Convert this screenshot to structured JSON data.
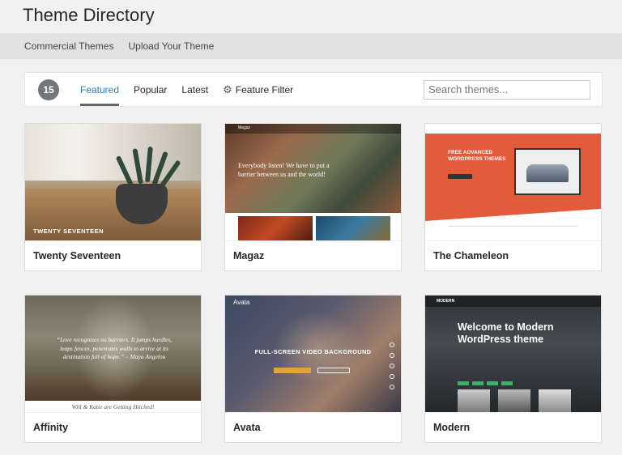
{
  "header": {
    "title": "Theme Directory"
  },
  "subnav": {
    "items": [
      "Commercial Themes",
      "Upload Your Theme"
    ]
  },
  "filter": {
    "count": "15",
    "tabs": [
      "Featured",
      "Popular",
      "Latest",
      "Feature Filter"
    ],
    "active_tab": "Featured",
    "search_placeholder": "Search themes..."
  },
  "themes": [
    {
      "name": "Twenty Seventeen",
      "preview_caption": "TWENTY SEVENTEEN"
    },
    {
      "name": "Magaz",
      "preview_logo": "Magaz",
      "preview_quote": "Everybody listen! We have to put a barrier between us and the world!"
    },
    {
      "name": "The Chameleon",
      "preview_heading": "FREE ADVANCED WORDPRESS THEMES"
    },
    {
      "name": "Affinity",
      "preview_quote": "“Love recognizes no barriers. It jumps hurdles, leaps fences, penetrates walls to arrive at its destination full of hope.” – Maya Angelou",
      "preview_strip": "Will & Katie are Getting Hitched!"
    },
    {
      "name": "Avata",
      "preview_logo": "Avata",
      "preview_heading": "FULL-SCREEN VIDEO BACKGROUND"
    },
    {
      "name": "Modern",
      "preview_logo": "MODERN",
      "preview_heading": "Welcome to Modern WordPress theme"
    }
  ],
  "colors": {
    "accent": "#2a7bb3",
    "badge": "#72777c",
    "subnav_bg": "#e2e2e2"
  }
}
